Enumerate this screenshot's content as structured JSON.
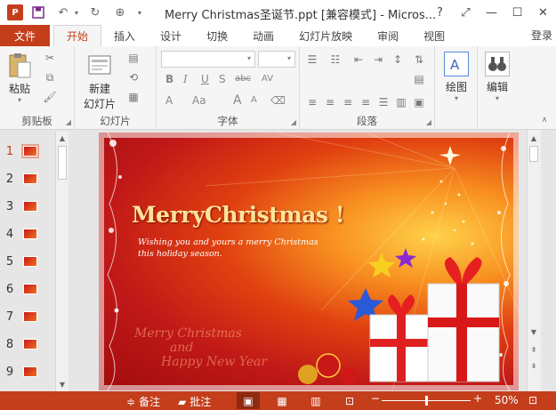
{
  "window": {
    "title": "Merry Christmas圣诞节.ppt [兼容模式] - Micros...",
    "app_icon_text": "P",
    "help": "?",
    "buttons": {
      "ribbon_display": "⤢",
      "minimize": "—",
      "maximize": "☐",
      "close": "✕"
    }
  },
  "qat": [
    "save-icon",
    "undo-icon",
    "redo-icon",
    "present-icon"
  ],
  "tabs": [
    {
      "label": "文件"
    },
    {
      "label": "开始"
    },
    {
      "label": "插入"
    },
    {
      "label": "设计"
    },
    {
      "label": "切换"
    },
    {
      "label": "动画"
    },
    {
      "label": "幻灯片放映"
    },
    {
      "label": "审阅"
    },
    {
      "label": "视图"
    }
  ],
  "active_tab": "开始",
  "login_label": "登录",
  "ribbon": {
    "clipboard": {
      "label": "剪贴板",
      "paste": "粘贴"
    },
    "slides": {
      "label": "幻灯片",
      "new_slide_line1": "新建",
      "new_slide_line2": "幻灯片"
    },
    "font": {
      "label": "字体",
      "bold": "B",
      "italic": "I",
      "underline": "U",
      "shadow": "S",
      "strike": "abc",
      "spacing": "AV",
      "font_color": "A",
      "case": "Aa",
      "grow": "A",
      "shrink": "A"
    },
    "paragraph": {
      "label": "段落"
    },
    "drawing": {
      "label": "绘图"
    },
    "editing": {
      "label": "编辑"
    }
  },
  "thumbnails": [
    {
      "num": "1",
      "selected": true
    },
    {
      "num": "2",
      "selected": false
    },
    {
      "num": "3",
      "selected": false
    },
    {
      "num": "4",
      "selected": false
    },
    {
      "num": "5",
      "selected": false
    },
    {
      "num": "6",
      "selected": false
    },
    {
      "num": "7",
      "selected": false
    },
    {
      "num": "8",
      "selected": false
    },
    {
      "num": "9",
      "selected": false
    }
  ],
  "slide": {
    "title": "MerryChristmas !",
    "subtitle_line1": "Wishing you and yours a merry Christmas",
    "subtitle_line2": "this holiday season.",
    "script_line1": "Merry Christmas",
    "script_line2": "and",
    "script_line3": "Happy New Year"
  },
  "statusbar": {
    "notes": "备注",
    "comments": "批注",
    "zoom_out": "−",
    "zoom_in": "+",
    "zoom": "50%",
    "zoom_fraction": 0.5
  },
  "colors": {
    "accent": "#c43e1c",
    "slide_red": "#c01818",
    "slide_gold": "#ffd24a"
  }
}
